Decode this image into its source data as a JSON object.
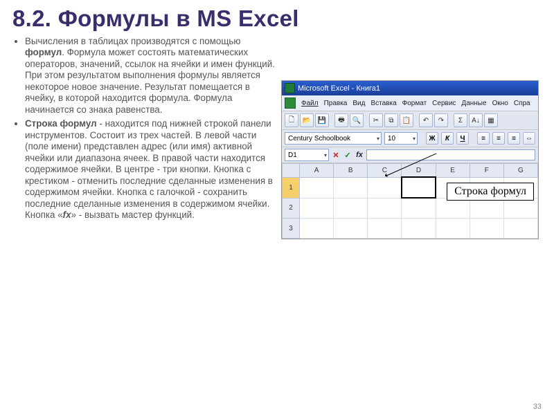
{
  "title": "8.2. Формулы в MS Excel",
  "bullets": {
    "p1a": "Вычисления в таблицах производятся с помощью ",
    "p1b": "формул",
    "p1c": ". Формула может состоять математических операторов, значений, ссылок на ячейки и имен функций. При этом результатом выполнения формулы является некоторое новое значение. Результат помещается в ячейку, в которой находится формула. Формула начинается со знака равенства.",
    "p2a": "Строка формул",
    "p2b": " - находится под нижней строкой панели инструментов. Состоит из трех частей. В левой части (поле имени) представлен адрес (или имя) активной ячейки или диапазона ячеек. В правой части находится содержимое ячейки. В центре - три кнопки. Кнопка с крестиком - отменить последние сделанные изменения в содержимом ячейки. Кнопка с галочкой - сохранить последние сделанные изменения в содержимом ячейки. Кнопка «",
    "p2c": "fx",
    "p2d": "» - вызвать мастер функций."
  },
  "excel": {
    "titlebar": "Microsoft Excel - Книга1",
    "menu": [
      "Файл",
      "Правка",
      "Вид",
      "Вставка",
      "Формат",
      "Сервис",
      "Данные",
      "Окно",
      "Спра"
    ],
    "font": "Century Schoolbook",
    "size": "10",
    "fmt": {
      "b": "Ж",
      "i": "К",
      "u": "Ч"
    },
    "namebox": "D1",
    "fbar": {
      "cancel": "✕",
      "ok": "✓",
      "fx": "fx"
    },
    "cols": [
      "A",
      "B",
      "C",
      "D",
      "E",
      "F",
      "G"
    ],
    "rows": [
      "1",
      "2",
      "3"
    ],
    "callout": "Строка формул"
  },
  "pagenum": "33"
}
